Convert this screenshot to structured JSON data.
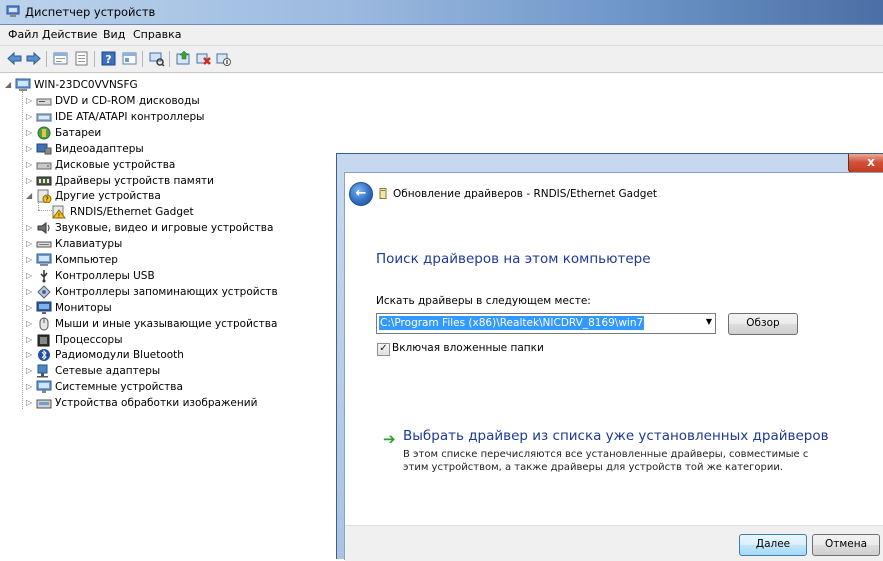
{
  "window": {
    "title": "Диспетчер устройств"
  },
  "menu": [
    "Файл",
    "Действие",
    "Вид",
    "Справка"
  ],
  "toolbar_icons": [
    "back-arrow-icon",
    "forward-arrow-icon",
    "properties-icon",
    "show-hide-icon",
    "help-icon",
    "view-icon",
    "scan-hardware-icon",
    "update-driver-icon",
    "uninstall-icon",
    "disable-icon"
  ],
  "tree": {
    "root": "WIN-23DC0VVNSFG",
    "items": [
      {
        "label": "DVD и CD-ROM дисководы",
        "icon": "dvd-drive-icon"
      },
      {
        "label": "IDE ATA/ATAPI контроллеры",
        "icon": "ide-controller-icon"
      },
      {
        "label": "Батареи",
        "icon": "battery-icon"
      },
      {
        "label": "Видеоадаптеры",
        "icon": "display-adapter-icon"
      },
      {
        "label": "Дисковые устройства",
        "icon": "disk-drive-icon"
      },
      {
        "label": "Драйверы устройств памяти",
        "icon": "memory-device-icon"
      },
      {
        "label": "Другие устройства",
        "icon": "other-devices-icon",
        "expanded": true
      },
      {
        "label": "RNDIS/Ethernet Gadget",
        "icon": "unknown-device-warning-icon",
        "child": true
      },
      {
        "label": "Звуковые, видео и игровые устройства",
        "icon": "sound-icon"
      },
      {
        "label": "Клавиатуры",
        "icon": "keyboard-icon"
      },
      {
        "label": "Компьютер",
        "icon": "computer-icon"
      },
      {
        "label": "Контроллеры USB",
        "icon": "usb-icon"
      },
      {
        "label": "Контроллеры запоминающих устройств",
        "icon": "storage-controller-icon"
      },
      {
        "label": "Мониторы",
        "icon": "monitor-icon"
      },
      {
        "label": "Мыши и иные указывающие устройства",
        "icon": "mouse-icon"
      },
      {
        "label": "Процессоры",
        "icon": "processor-icon"
      },
      {
        "label": "Радиомодули Bluetooth",
        "icon": "bluetooth-icon"
      },
      {
        "label": "Сетевые адаптеры",
        "icon": "network-adapter-icon"
      },
      {
        "label": "Системные устройства",
        "icon": "system-devices-icon"
      },
      {
        "label": "Устройства обработки изображений",
        "icon": "imaging-device-icon"
      }
    ]
  },
  "dialog": {
    "close_label": "x",
    "back_label": "←",
    "header_title": "Обновление драйверов - RNDIS/Ethernet Gadget",
    "heading": "Поиск драйверов на этом компьютере",
    "location_label": "Искать драйверы в следующем месте:",
    "path_value": "C:\\Program Files (x86)\\Realtek\\NICDRV_8169\\win7",
    "browse_label": "Обзор",
    "include_subfolders_label": "Включая вложенные папки",
    "include_subfolders_checked": true,
    "pick_link_title": "Выбрать драйвер из списка уже установленных драйверов",
    "pick_link_desc": "В этом списке перечисляются все установленные драйверы, совместимые с этим устройством, а также драйверы для устройств той же категории.",
    "next_label": "Далее",
    "cancel_label": "Отмена"
  }
}
